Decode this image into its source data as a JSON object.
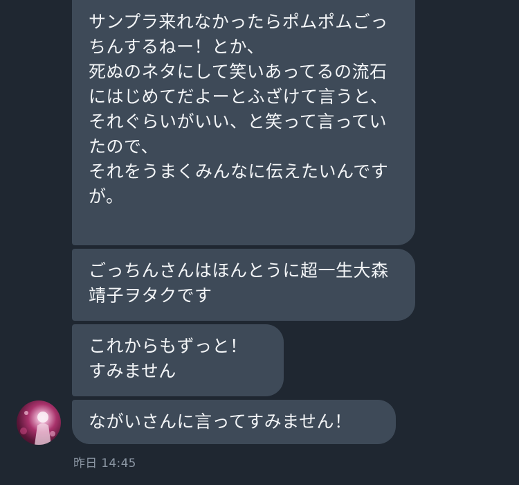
{
  "messages": [
    {
      "text": "サンプラ来れなかったらポムポムごっちんするねー！とか、\n死ぬのネタにして笑いあってるの流石にはじめてだよーとふざけて言うと、\nそれぐらいがいい、と笑って言っていたので、\nそれをうまくみんなに伝えたいんですが。"
    },
    {
      "text": "ごっちんさんはほんとうに超一生大森靖子ヲタクです"
    },
    {
      "text": "これからもずっと！\nすみません"
    },
    {
      "text": "ながいさんに言ってすみません！"
    }
  ],
  "timestamp": "昨日 14:45",
  "avatar_icon": "user-avatar",
  "colors": {
    "background": "#1f2731",
    "bubble": "#3e4a58",
    "text": "#f3f5f7",
    "timestamp": "#8b96a3"
  }
}
